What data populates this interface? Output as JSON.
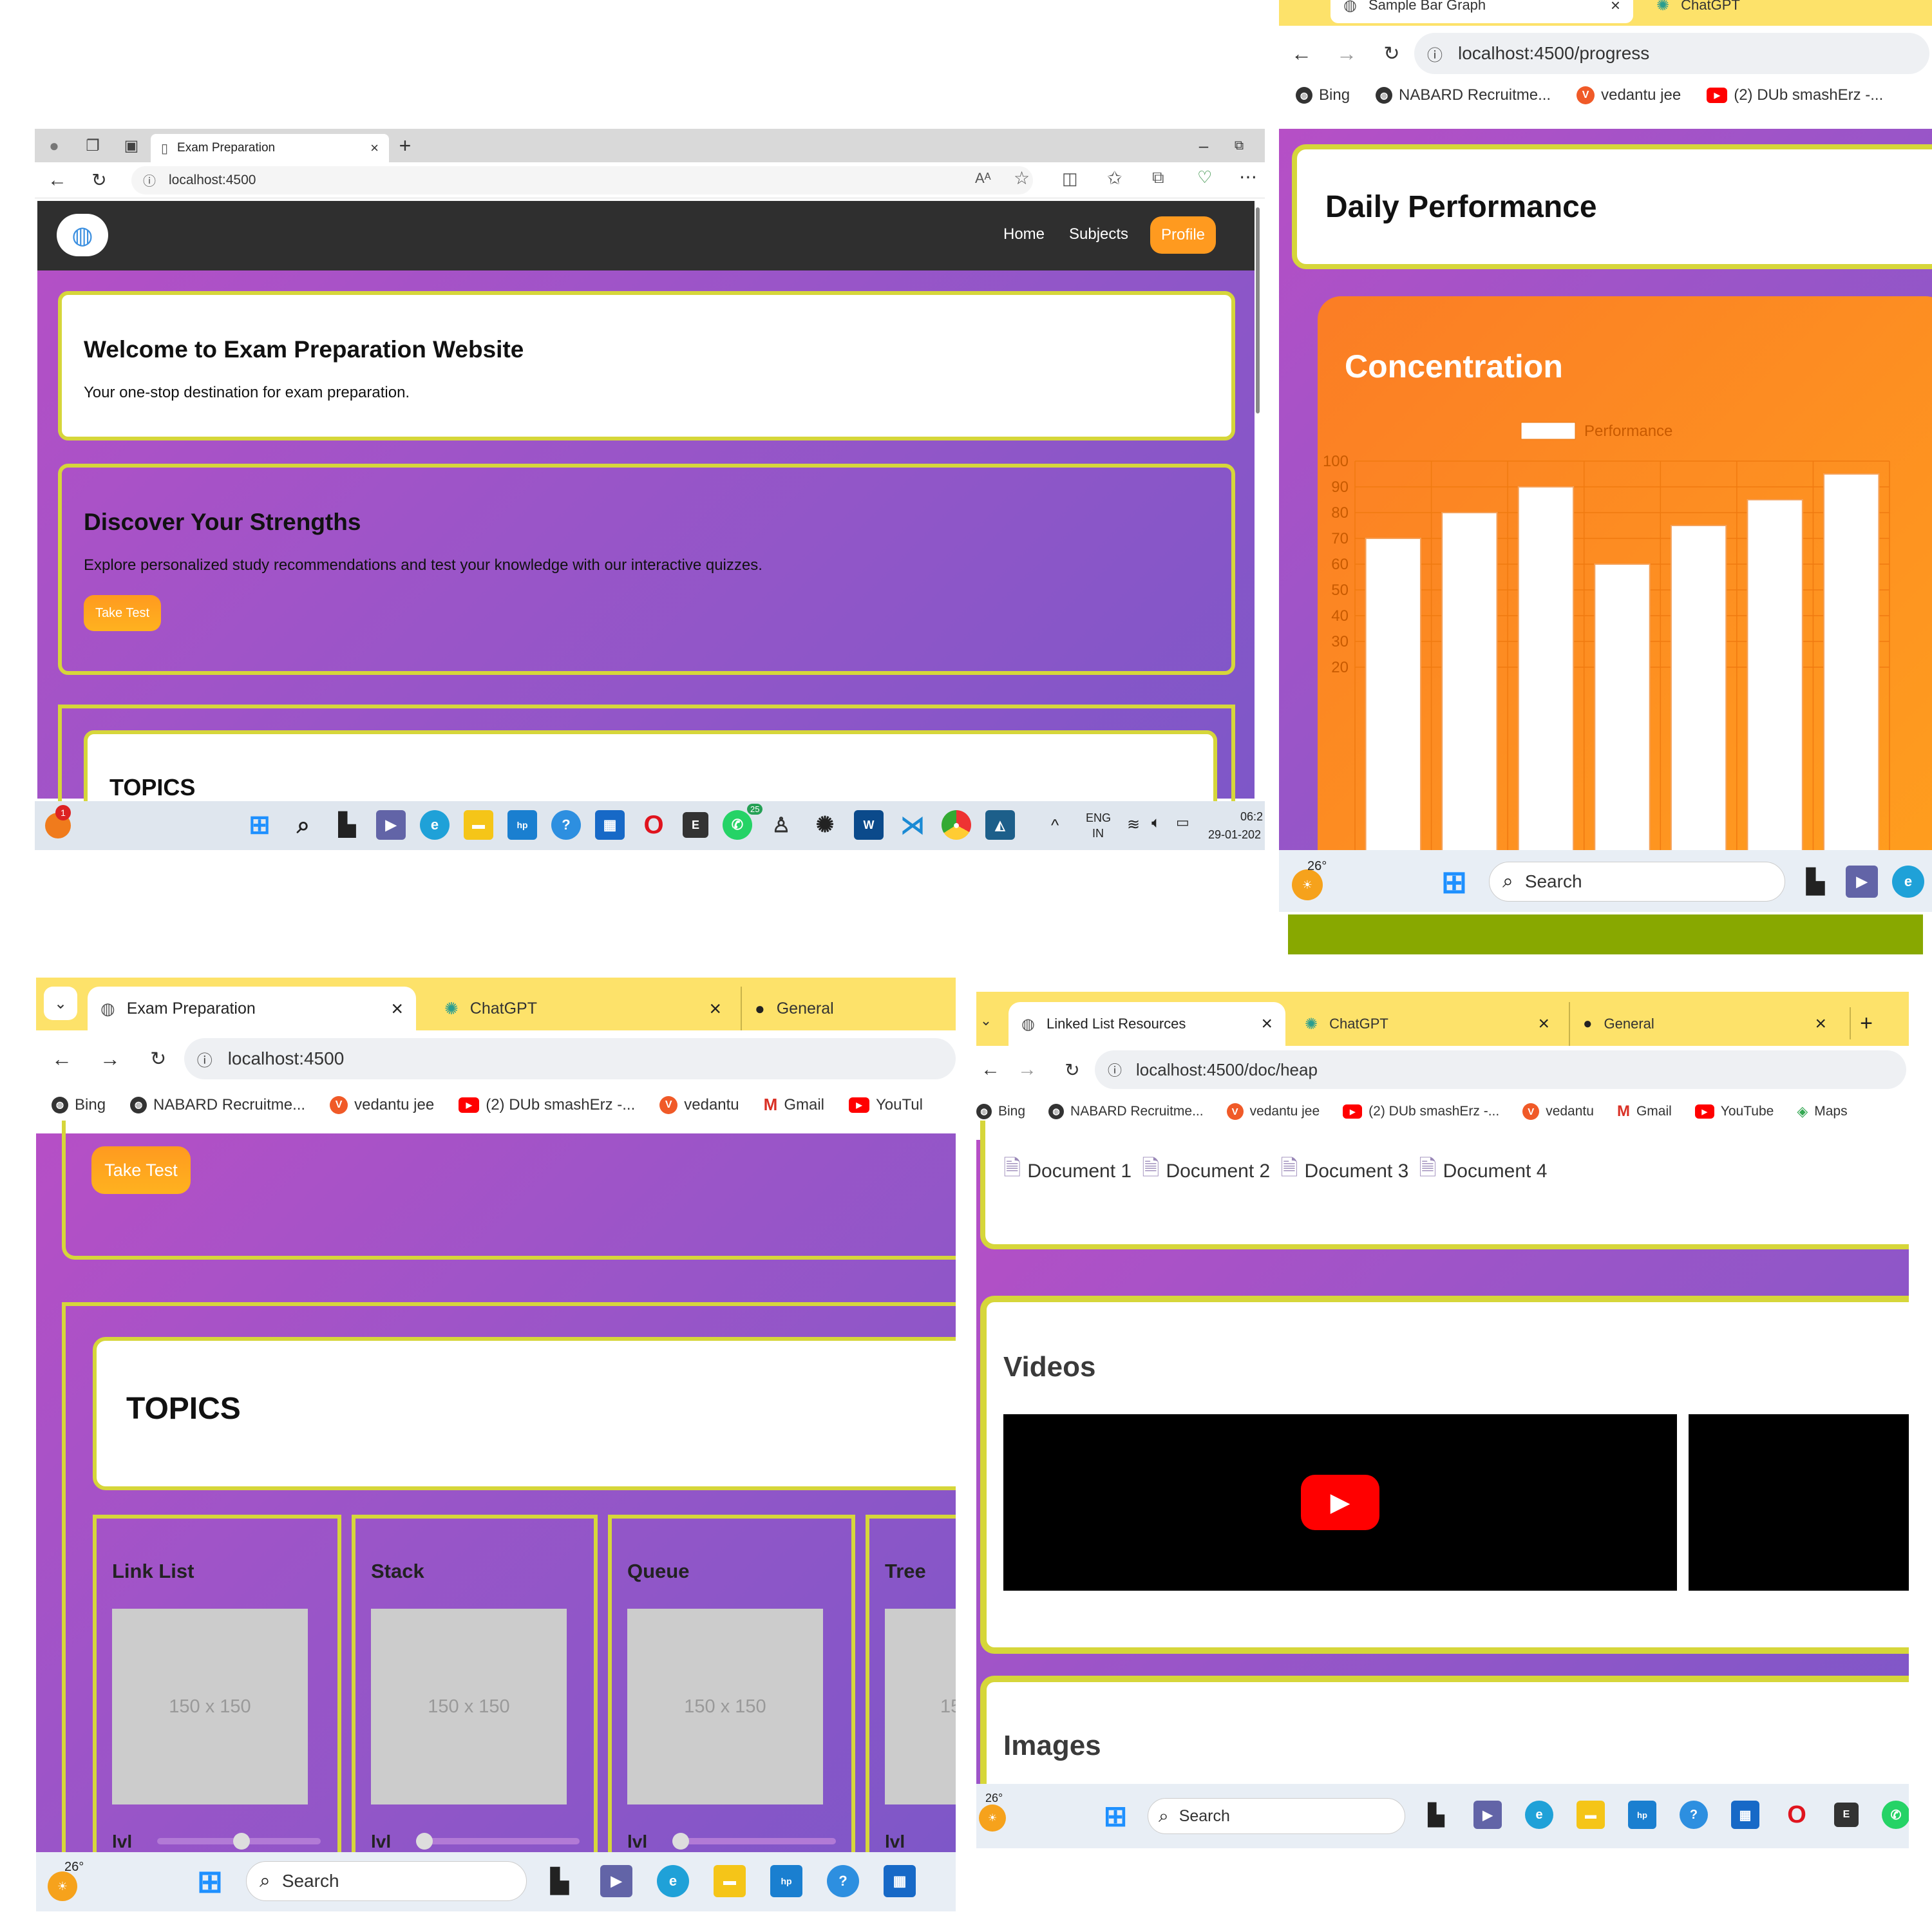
{
  "p1": {
    "tab_title": "Exam Preparation",
    "new_tab": "+",
    "url": "localhost:4500",
    "read_aloud": "Aᴬ",
    "nav": {
      "home": "Home",
      "subjects": "Subjects",
      "profile": "Profile"
    },
    "welcome": {
      "title": "Welcome to Exam Preparation Website",
      "text": "Your one-stop destination for exam preparation."
    },
    "discover": {
      "title": "Discover Your Strengths",
      "text": "Explore personalized study recommendations and test your knowledge with our interactive quizzes.",
      "button": "Take Test"
    },
    "topics_title": "TOPICS",
    "taskbar": {
      "badge": "1",
      "whatsapp_badge": "25",
      "lang": "ENG",
      "region": "IN",
      "time": "06:2",
      "date": "29-01-202"
    }
  },
  "p2": {
    "tabs": [
      "Sample Bar Graph",
      "ChatGPT"
    ],
    "url": "localhost:4500/progress",
    "bookmarks": [
      "Bing",
      "NABARD Recruitme...",
      "vedantu jee",
      "(2) DUb smashErz -..."
    ],
    "heading": "Daily Performance",
    "chart_title": "Concentration",
    "weather": "26°",
    "search": "Search"
  },
  "chart_data": {
    "type": "bar",
    "series": [
      {
        "name": "Performance",
        "values": [
          70,
          80,
          90,
          60,
          75,
          85,
          95
        ]
      }
    ],
    "yticks": [
      100,
      90,
      80,
      70,
      60,
      50,
      40,
      30,
      20
    ],
    "ylim": [
      20,
      100
    ],
    "grid": true,
    "legend": "top",
    "colors": {
      "bars": "#ffffff",
      "background": "#f98b1c",
      "grid": "#f07a10",
      "text": "#c85a00"
    }
  },
  "p3": {
    "tabs": [
      "Exam Preparation",
      "ChatGPT",
      "General"
    ],
    "url": "localhost:4500",
    "bookmarks": [
      "Bing",
      "NABARD Recruitme...",
      "vedantu jee",
      "(2) DUb smashErz -...",
      "vedantu",
      "Gmail",
      "YouTul"
    ],
    "take_test": "Take Test",
    "topics_title": "TOPICS",
    "topics": [
      {
        "name": "Link List",
        "img": "150 x 150",
        "lvl": "lvl"
      },
      {
        "name": "Stack",
        "img": "150 x 150",
        "lvl": "lvl"
      },
      {
        "name": "Queue",
        "img": "150 x 150",
        "lvl": "lvl"
      },
      {
        "name": "Tree",
        "img": "15",
        "lvl": "lvl"
      }
    ],
    "weather": "26°",
    "search": "Search"
  },
  "p4": {
    "tabs": [
      "Linked List Resources",
      "ChatGPT",
      "General"
    ],
    "new_tab": "+",
    "url": "localhost:4500/doc/heap",
    "bookmarks": [
      "Bing",
      "NABARD Recruitme...",
      "vedantu jee",
      "(2) DUb smashErz -...",
      "vedantu",
      "Gmail",
      "YouTube",
      "Maps"
    ],
    "documents": [
      "Document 1",
      "Document 2",
      "Document 3",
      "Document 4"
    ],
    "videos_title": "Videos",
    "images_title": "Images",
    "weather": "26°",
    "search": "Search"
  },
  "colors": {
    "accent_orange": "#ff9a1f",
    "card_border": "#d6d63a",
    "tab_yellow": "#fde26a",
    "nav_dark": "#2f2f2f"
  }
}
